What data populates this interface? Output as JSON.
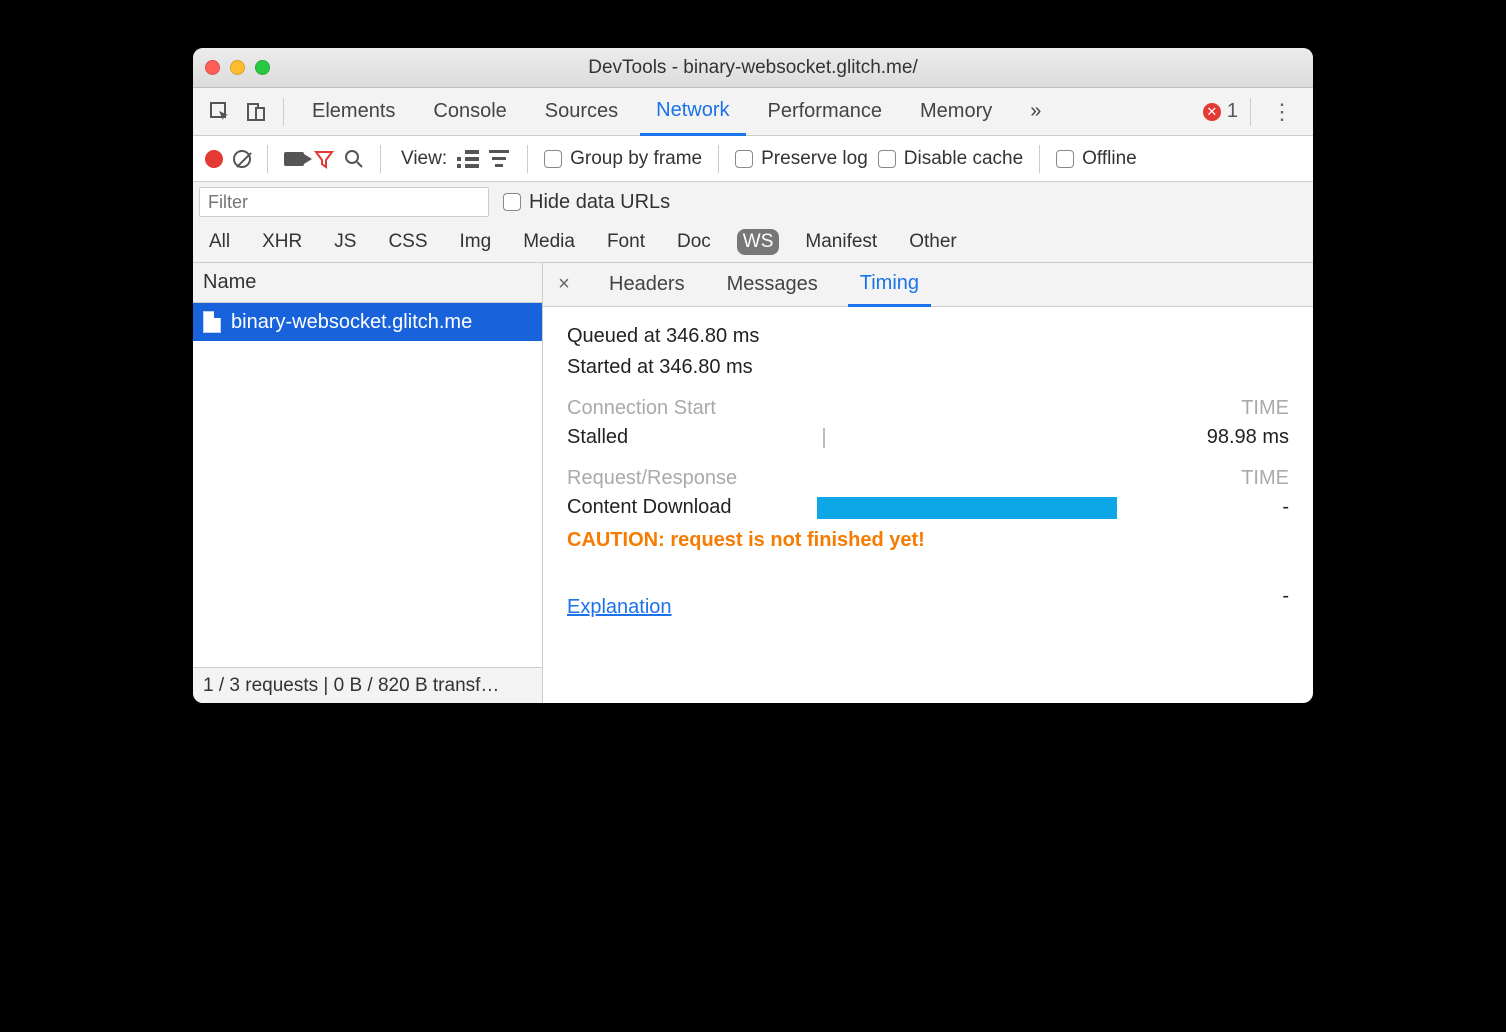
{
  "window": {
    "title": "DevTools - binary-websocket.glitch.me/"
  },
  "tabs": {
    "items": [
      "Elements",
      "Console",
      "Sources",
      "Network",
      "Performance",
      "Memory"
    ],
    "active": "Network",
    "overflow_glyph": "»",
    "error_count": "1"
  },
  "toolbar": {
    "view_label": "View:",
    "group_by_frame": "Group by frame",
    "preserve_log": "Preserve log",
    "disable_cache": "Disable cache",
    "offline": "Offline"
  },
  "filter": {
    "placeholder": "Filter",
    "hide_data_urls": "Hide data URLs",
    "types": [
      "All",
      "XHR",
      "JS",
      "CSS",
      "Img",
      "Media",
      "Font",
      "Doc",
      "WS",
      "Manifest",
      "Other"
    ],
    "active_type": "WS"
  },
  "left": {
    "header": "Name",
    "requests": [
      {
        "name": "binary-websocket.glitch.me"
      }
    ],
    "status": "1 / 3 requests | 0 B / 820 B transf…"
  },
  "detail": {
    "tabs": [
      "Headers",
      "Messages",
      "Timing"
    ],
    "active": "Timing",
    "close_glyph": "×"
  },
  "timing": {
    "queued": "Queued at 346.80 ms",
    "started": "Started at 346.80 ms",
    "connection_start": "Connection Start",
    "time_col": "TIME",
    "stalled_label": "Stalled",
    "stalled_value": "98.98 ms",
    "request_response": "Request/Response",
    "content_download": "Content Download",
    "content_download_value": "-",
    "caution": "CAUTION: request is not finished yet!",
    "explanation": "Explanation",
    "explanation_value": "-"
  }
}
